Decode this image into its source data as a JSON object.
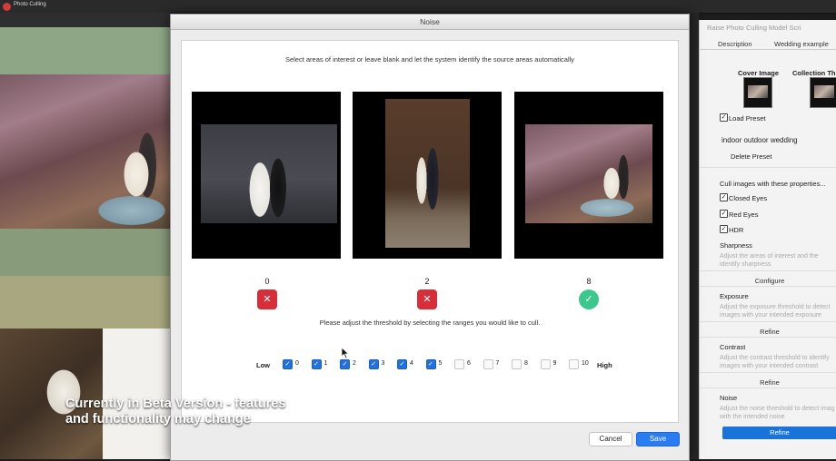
{
  "app": {
    "title": "Photo Culling"
  },
  "beta_notice": {
    "line1": "Currently in Beta Version - features",
    "line2": "and functionality may change"
  },
  "modal": {
    "title": "Noise",
    "instruction": "Select areas of interest or leave blank and let the system identify the source areas automatically",
    "images": [
      {
        "score": "0",
        "status": "rejected",
        "status_icon": "✕"
      },
      {
        "score": "2",
        "status": "rejected",
        "status_icon": "✕"
      },
      {
        "score": "8",
        "status": "accepted",
        "status_icon": "✓"
      }
    ],
    "threshold_text": "Please adjust the threshold by selecting the ranges you would like to cull.",
    "range": {
      "low_label": "Low",
      "high_label": "High",
      "items": [
        {
          "label": "0",
          "checked": true
        },
        {
          "label": "1",
          "checked": true
        },
        {
          "label": "2",
          "checked": true
        },
        {
          "label": "3",
          "checked": true
        },
        {
          "label": "4",
          "checked": true
        },
        {
          "label": "5",
          "checked": true
        },
        {
          "label": "6",
          "checked": false
        },
        {
          "label": "7",
          "checked": false
        },
        {
          "label": "8",
          "checked": false
        },
        {
          "label": "9",
          "checked": false
        },
        {
          "label": "10",
          "checked": false
        }
      ]
    },
    "cancel_label": "Cancel",
    "save_label": "Save"
  },
  "right_panel": {
    "title": "Raise Photo Culling Model Scri",
    "tabs": [
      "Description",
      "Wedding example"
    ],
    "cover_image": "Cover Image",
    "collection_thumb": "Collection Thum",
    "load_preset": "Load Preset",
    "preset_name": "indoor outdoor wedding",
    "delete_preset": "Delete Preset",
    "cull_heading": "Cull images with these properties...",
    "closed_eyes": "Closed Eyes",
    "red_eyes": "Red Eyes",
    "hdr": "HDR",
    "sharpness": "Sharpness",
    "sharpness_desc_1": "Adjust the areas of interest and the",
    "sharpness_desc_2": "identify sharpness",
    "configure": "Configure",
    "exposure": "Exposure",
    "exposure_desc_1": "Adjust the exposure threshold to detect",
    "exposure_desc_2": "images with your intended exposure",
    "refine_1": "Refine",
    "contrast": "Contrast",
    "contrast_desc_1": "Adjust the contrast threshold to identify",
    "contrast_desc_2": "images with your intended contrast",
    "refine_2": "Refine",
    "noise": "Noise",
    "noise_desc_1": "Adjust the noise threshold to detect imag",
    "noise_desc_2": "with the intended noise",
    "refine_3": "Refine"
  },
  "colors": {
    "accent": "#2a7df0",
    "reject": "#d72f3a",
    "accept": "#3dc78d"
  }
}
